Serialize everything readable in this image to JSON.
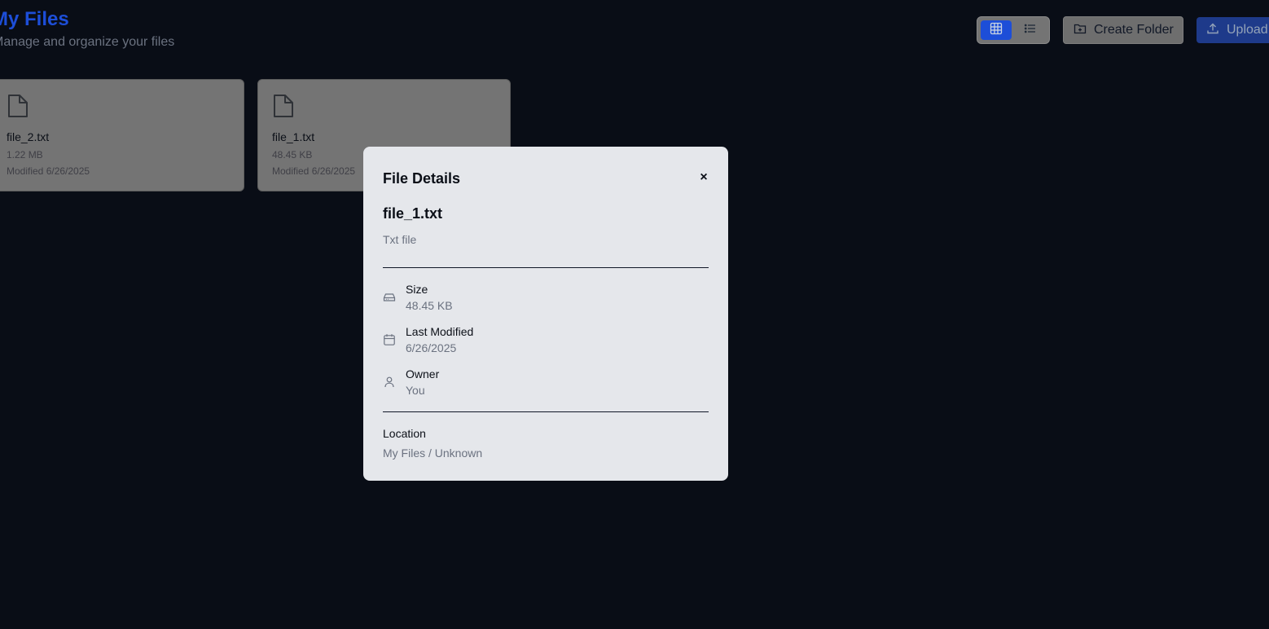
{
  "header": {
    "title": "My Files",
    "subtitle": "Manage and organize your files"
  },
  "toolbar": {
    "view_modes": [
      {
        "name": "grid-view",
        "icon": "grid-icon",
        "active": true
      },
      {
        "name": "list-view",
        "icon": "list-icon",
        "active": false
      }
    ],
    "create_folder_label": "Create Folder",
    "upload_label": "Upload"
  },
  "files": [
    {
      "name": "file_2.txt",
      "size": "1.22 MB",
      "modified": "Modified 6/26/2025",
      "icon": "file-icon"
    },
    {
      "name": "file_1.txt",
      "size": "48.45 KB",
      "modified": "Modified 6/26/2025",
      "icon": "file-icon"
    }
  ],
  "modal": {
    "title": "File Details",
    "close_glyph": "×",
    "file_name": "file_1.txt",
    "file_type": "Txt file",
    "details": [
      {
        "label": "Size",
        "value": "48.45 KB",
        "icon": "hard-drive-icon"
      },
      {
        "label": "Last Modified",
        "value": "6/26/2025",
        "icon": "calendar-icon"
      },
      {
        "label": "Owner",
        "value": "You",
        "icon": "user-icon"
      }
    ],
    "location_label": "Location",
    "location_value": "My Files / Unknown"
  },
  "colors": {
    "background": "#090d16",
    "accent": "#1d4ed8",
    "modal_bg": "#e5e7eb"
  }
}
